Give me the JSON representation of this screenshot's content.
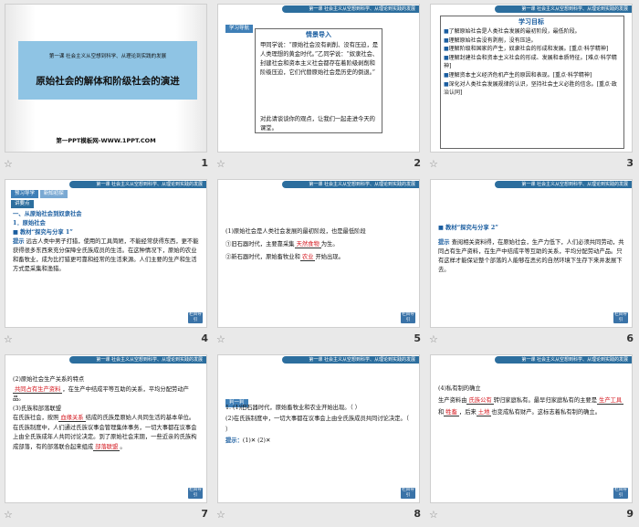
{
  "header_text": "第一课 社会主义从空想到科学、从理论到实践的发展",
  "back_label": "栏目导引",
  "slides": [
    {
      "num": "1",
      "subtitle": "第一课 社会主义从空想到科学、从理论到实践的发展",
      "title": "原始社会的解体和阶级社会的演进",
      "footer": "第一PPT模板网-WWW.1PPT.COM"
    },
    {
      "num": "2",
      "tag": "学习导航",
      "section_title": "情景导入",
      "text": "甲同学说：“原始社会没有剥削、没有压迫，是人类理想的黄金时代。”乙同学说：“奴隶社会、封建社会和资本主义社会都存在着阶级剥削和阶级压迫，它们代替原始社会是历史的倒退。”",
      "text2": "对此请谈谈你的观点，让我们一起走进今天的课堂。"
    },
    {
      "num": "3",
      "section_title": "学习目标",
      "items": [
        "了解原始社会是人类社会发展的最初阶段，最低阶段。",
        "理解原始社会没有剥削，没有压迫。",
        "理解阶级和国家的产生，奴隶社会的形成和发展。[重点·科学精神]",
        "理解封建社会和资本主义社会的形成、发展和本质特征。[难点·科学精神]",
        "理解资本主义经济危机产生的原因和表现。[重点·科学精神]",
        "深化对人类社会发展规律的认识，坚持社会主义必胜的信念。[重点·政治认同]"
      ]
    },
    {
      "num": "4",
      "tag1": "预习导学",
      "tag2": "新知初探",
      "tag3": "讲要点",
      "heading": "一、从原始社会到奴隶社会",
      "sub": "1．原始社会",
      "topic": "教材“探究与分享 1”",
      "tip_label": "提示",
      "text": "远古人类中男子打猎，使用的工具简陋，不能经常获得东西，更不能获得很多东西来充分保障全氏族成员的生活。在这种情况下，原始的农业和畜牧业，成为比打猎更可靠和经常的生活来源。人们主要的生产和生活方式是采集和渔猎。"
    },
    {
      "num": "5",
      "line1": "(1)原始社会是人类社会发展的最初阶段，也是最低阶段",
      "line2a": "①旧石器时代，主要靠采集",
      "fill1": "天然食物",
      "line2b": "为生。",
      "line3a": "②新石器时代，原始畜牧业和",
      "fill2": "农业",
      "line3b": "开始出现。"
    },
    {
      "num": "6",
      "topic": "教材“探究与分享 2”",
      "tip_label": "提示",
      "text": "查阅相关资料得，在原始社会，生产力低下，人们必须共同劳动，共同占有生产资料，在生产中结成平等互助的关系，平均分配劳动产品。只有这样才能保证整个部落的人能够在恶劣的自然环境下生存下来并发展下去。"
    },
    {
      "num": "7",
      "line1": "(2)原始社会生产关系的特点",
      "fill1": "共同占有生产资料",
      "line1b": "，在生产中结成平等互助的关系，平均分配劳动产品。",
      "line2": "(3)氏族和部落联盟",
      "line3a": "在氏族社会，按照",
      "fill2": "血缘关系",
      "line3b": "结成的氏族是原始人共同生活的基本单位。在氏族制度中，人们通过氏族议事会管理集体事务，一切大事都在议事会上由全氏族成年人共同讨论决定。到了原始社会末期，一些近亲的氏族构成部落，有的部落联合起来组成",
      "fill3": "部落联盟",
      "line3c": "。"
    },
    {
      "num": "8",
      "tag": "判一判",
      "q1": "1. (1)旧石器时代，原始畜牧业和农业开始出现。（  ）",
      "q2": "(2)在氏族制度中，一切大事都在议事会上由全氏族成员共同讨论决定。（  ）",
      "ans_label": "提示：",
      "ans": "(1)✕  (2)✕"
    },
    {
      "num": "9",
      "line1": "(4)私有制的确立",
      "line2a": "生产资料由",
      "fill1": "氏族公有",
      "line2b": "转归家庭私有。最早归家庭私有的主要是",
      "fill2": "生产工具",
      "line2c": "和",
      "fill3": "牲畜",
      "line2d": "，后来",
      "fill4": "土地",
      "line2e": "也变成私有财产。这标志着私有制的确立。"
    }
  ]
}
